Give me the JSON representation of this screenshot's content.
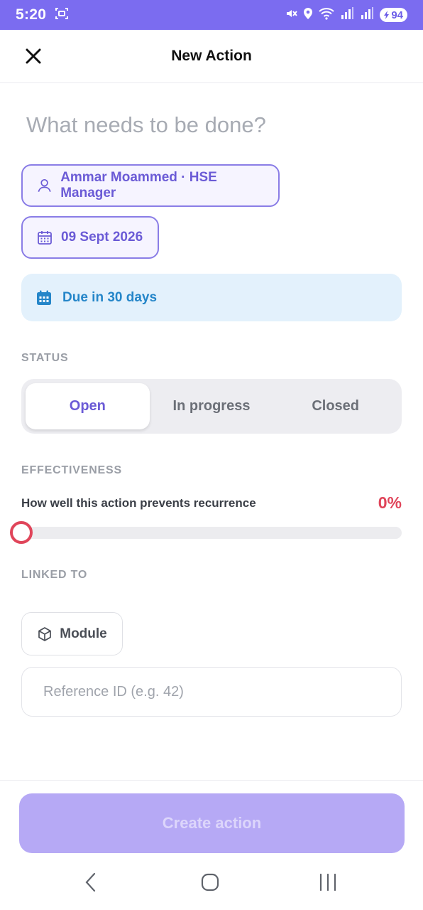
{
  "status_bar": {
    "time": "5:20",
    "battery": "94"
  },
  "header": {
    "title": "New Action"
  },
  "form": {
    "title_placeholder": "What needs to be done?",
    "assignee": "Ammar Moammed · HSE Manager",
    "due_date": "09 Sept 2026",
    "due_notice": "Due in 30 days"
  },
  "status_section": {
    "label": "STATUS",
    "options": [
      "Open",
      "In progress",
      "Closed"
    ],
    "selected": "Open"
  },
  "effectiveness": {
    "label": "EFFECTIVENESS",
    "description": "How well this action prevents recurrence",
    "value_text": "0%",
    "value": 0
  },
  "linked": {
    "label": "LINKED TO",
    "module_label": "Module",
    "reference_placeholder": "Reference ID (e.g. 42)"
  },
  "footer": {
    "create_label": "Create action"
  },
  "colors": {
    "brand": "#7b6cf0",
    "accent_red": "#e0455a",
    "info_blue": "#2586c9"
  }
}
